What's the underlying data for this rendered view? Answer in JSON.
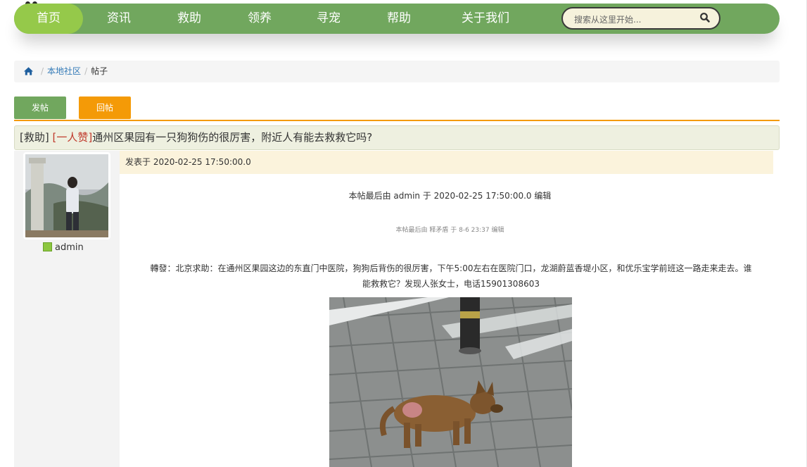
{
  "nav": {
    "items": [
      {
        "label": "首页",
        "active": true
      },
      {
        "label": "资讯",
        "active": false
      },
      {
        "label": "救助",
        "active": false
      },
      {
        "label": "领养",
        "active": false
      },
      {
        "label": "寻宠",
        "active": false
      },
      {
        "label": "帮助",
        "active": false
      },
      {
        "label": "关于我们",
        "active": false
      }
    ],
    "search": {
      "placeholder": "搜索从这里开始...",
      "value": "",
      "icon": "search-icon"
    }
  },
  "breadcrumb": {
    "home_icon": "home-icon",
    "items": [
      "本地社区",
      "帖子"
    ]
  },
  "actions": {
    "post_label": "发帖",
    "reply_label": "回帖"
  },
  "thread": {
    "category": "[救助]",
    "tag": "[一人赞]",
    "title": "通州区果园有一只狗狗伤的很厉害，附近人有能去救救它吗?"
  },
  "author": {
    "name": "admin",
    "user_icon": "user-icon"
  },
  "post": {
    "posted_at": "发表于 2020-02-25 17:50:00.0",
    "edit_note_main": "本帖最后由 admin 于 2020-02-25 17:50:00.0 编辑",
    "edit_note_quoted": "本帖最后由 释矛盾 于 8-6 23:37 编辑",
    "body_line_1": "轉發：北京求助：在通州区果园这边的东直门中医院，狗狗后背伤的很厉害，下午5:00左右在医院门口，龙湖蔚蓝香堤小区，和优乐宝学前班这一路走来走去。谁",
    "body_line_2": "能救救它？发现人张女士，电话15901308603"
  },
  "colors": {
    "nav_green": "#71a75e",
    "nav_active": "#95c94a",
    "reply_orange": "#f49a07",
    "link_blue": "#337ab7",
    "tag_red": "#c0392b"
  }
}
